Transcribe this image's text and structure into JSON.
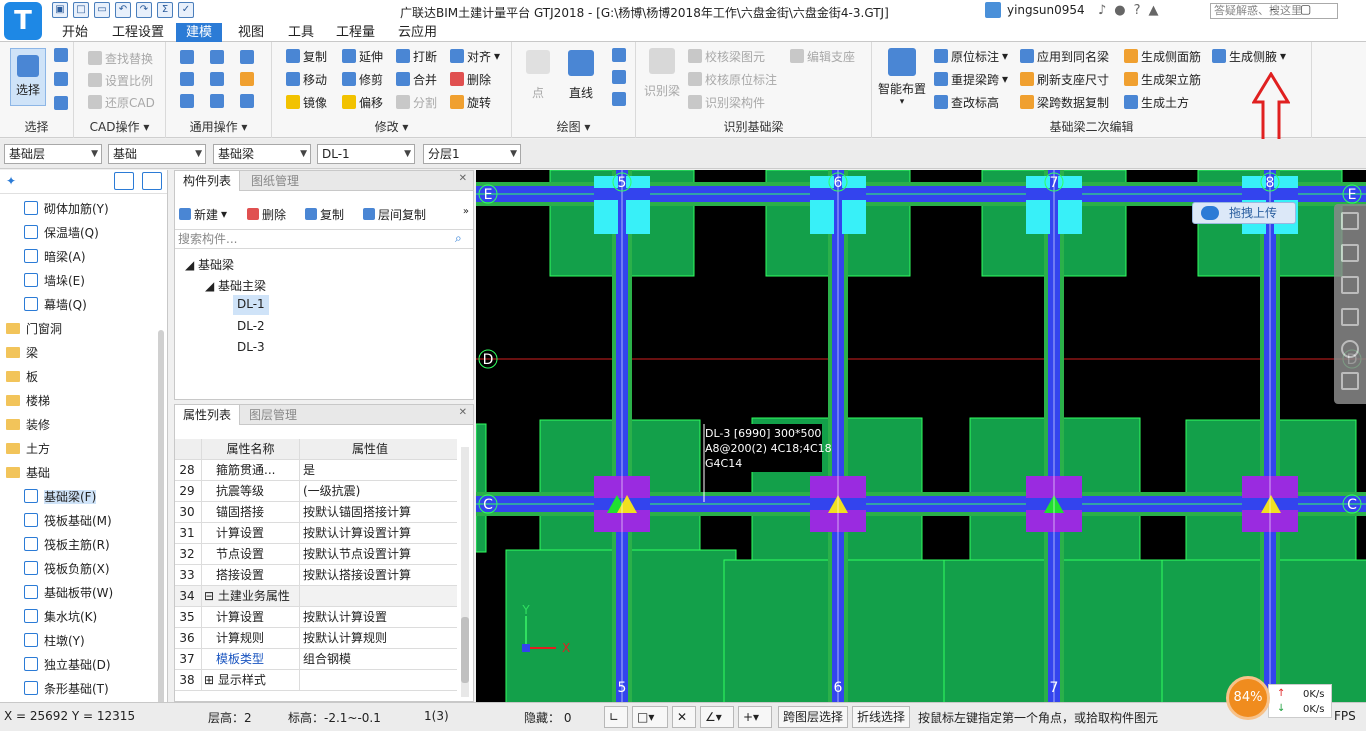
{
  "app": {
    "logo_letter": "T",
    "title": "广联达BIM土建计量平台 GTJ2018 - [G:\\杨博\\杨博2018年工作\\六盘金街\\六盘金街4-3.GTJ]",
    "username": "yingsun0954",
    "help_search_placeholder": "答疑解惑、搜这里"
  },
  "tabs": [
    "开始",
    "工程设置",
    "建模",
    "视图",
    "工具",
    "工程量",
    "云应用"
  ],
  "active_tab": "建模",
  "ribbon": {
    "select_group": {
      "label": "选择",
      "big_button": "选择"
    },
    "cad_group": {
      "label": "CAD操作",
      "buttons": [
        "查找替换",
        "设置比例",
        "还原CAD"
      ]
    },
    "common_group": {
      "label": "通用操作"
    },
    "modify_group": {
      "label": "修改",
      "buttons": [
        "复制",
        "延伸",
        "打断",
        "对齐",
        "移动",
        "修剪",
        "合并",
        "删除",
        "镜像",
        "偏移",
        "分割",
        "旋转"
      ]
    },
    "draw_group": {
      "label": "绘图",
      "buttons": [
        "点",
        "直线"
      ]
    },
    "identify_group": {
      "label": "识别基础梁",
      "big_button": "识别梁",
      "buttons": [
        "校核梁图元",
        "校核原位标注",
        "识别梁构件",
        "编辑支座"
      ]
    },
    "edit_group": {
      "label": "基础梁二次编辑",
      "big_button": "智能布置",
      "buttons": [
        "原位标注",
        "应用到同名梁",
        "生成侧面筋",
        "生成侧腋",
        "重提梁跨",
        "刷新支座尺寸",
        "生成架立筋",
        "查改标高",
        "梁跨数据复制",
        "生成土方"
      ]
    }
  },
  "combos": [
    "基础层",
    "基础",
    "基础梁",
    "DL-1",
    "分层1"
  ],
  "left_tree": [
    {
      "label": "砌体加筋(Y)",
      "type": "item"
    },
    {
      "label": "保温墙(Q)",
      "type": "item"
    },
    {
      "label": "暗梁(A)",
      "type": "item"
    },
    {
      "label": "墙垛(E)",
      "type": "item"
    },
    {
      "label": "幕墙(Q)",
      "type": "item"
    },
    {
      "label": "门窗洞",
      "type": "folder"
    },
    {
      "label": "梁",
      "type": "folder"
    },
    {
      "label": "板",
      "type": "folder"
    },
    {
      "label": "楼梯",
      "type": "folder"
    },
    {
      "label": "装修",
      "type": "folder"
    },
    {
      "label": "土方",
      "type": "folder"
    },
    {
      "label": "基础",
      "type": "folder"
    },
    {
      "label": "基础梁(F)",
      "type": "item"
    },
    {
      "label": "筏板基础(M)",
      "type": "item"
    },
    {
      "label": "筏板主筋(R)",
      "type": "item"
    },
    {
      "label": "筏板负筋(X)",
      "type": "item"
    },
    {
      "label": "基础板带(W)",
      "type": "item"
    },
    {
      "label": "集水坑(K)",
      "type": "item"
    },
    {
      "label": "柱墩(Y)",
      "type": "item"
    },
    {
      "label": "独立基础(D)",
      "type": "item"
    },
    {
      "label": "条形基础(T)",
      "type": "item"
    }
  ],
  "comp_panel": {
    "tabs": [
      "构件列表",
      "图纸管理"
    ],
    "toolbar": [
      "新建",
      "删除",
      "复制",
      "层间复制"
    ],
    "search_placeholder": "搜索构件...",
    "tree": {
      "root": "基础梁",
      "group": "基础主梁",
      "items": [
        "DL-1",
        "DL-2",
        "DL-3"
      ]
    }
  },
  "prop_panel": {
    "tabs": [
      "属性列表",
      "图层管理"
    ],
    "headers": [
      "属性名称",
      "属性值"
    ],
    "rows": [
      {
        "num": "28",
        "name": "箍筋贯通...",
        "value": "是"
      },
      {
        "num": "29",
        "name": "抗震等级",
        "value": "(一级抗震)"
      },
      {
        "num": "30",
        "name": "锚固搭接",
        "value": "按默认锚固搭接计算"
      },
      {
        "num": "31",
        "name": "计算设置",
        "value": "按默认计算设置计算"
      },
      {
        "num": "32",
        "name": "节点设置",
        "value": "按默认节点设置计算"
      },
      {
        "num": "33",
        "name": "搭接设置",
        "value": "按默认搭接设置计算"
      },
      {
        "num": "34",
        "name": "土建业务属性",
        "value": ""
      },
      {
        "num": "35",
        "name": "计算设置",
        "value": "按默认计算设置"
      },
      {
        "num": "36",
        "name": "计算规则",
        "value": "按默认计算规则"
      },
      {
        "num": "37",
        "name": "模板类型",
        "value": "组合钢模"
      },
      {
        "num": "38",
        "name": "显示样式",
        "value": ""
      }
    ]
  },
  "canvas": {
    "upload_label": "拖拽上传",
    "axes_vertical": [
      "5",
      "6",
      "7",
      "8"
    ],
    "axes_horizontal": [
      "E",
      "D",
      "C"
    ],
    "annotation": [
      "DL-3 [6990] 300*500",
      "A8@200(2) 4C18;4C18",
      "G4C14"
    ],
    "axis_labels": [
      "X",
      "Y"
    ]
  },
  "statusbar": {
    "coords": "X = 25692 Y = 12315",
    "floor_height": "层高：2",
    "elevation": "标高：-2.1~-0.1",
    "count": "1(3)",
    "hidden": "隐藏： 0",
    "cross_layer": "跨图层选择",
    "polyline": "折线选择",
    "hint": "按鼠标左键指定第一个角点，或拾取构件图元",
    "fps": "FPS",
    "speed_percent": "84%",
    "speed_up": "0K/s",
    "speed_down": "0K/s"
  }
}
